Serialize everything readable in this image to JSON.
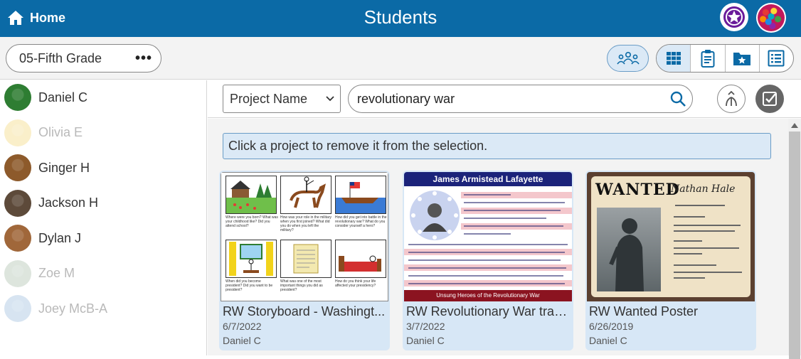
{
  "header": {
    "home_label": "Home",
    "title": "Students",
    "colors": {
      "bar": "#0b6aa6",
      "badge": "#6a1b9a"
    },
    "icons": {
      "home": "home-icon",
      "badge": "star-badge-icon",
      "avatar": "user-avatar"
    }
  },
  "toolbar": {
    "class_label": "05-Fifth Grade",
    "more_label": "•••",
    "icons": [
      "group-icon",
      "grid-view-icon",
      "clipboard-icon",
      "folder-star-icon",
      "list-view-icon"
    ]
  },
  "students": [
    {
      "name": "Daniel C",
      "dim": false,
      "color": "#2e7d32"
    },
    {
      "name": "Olivia E",
      "dim": true,
      "color": "#f1d36b"
    },
    {
      "name": "Ginger H",
      "dim": false,
      "color": "#8d5a2b"
    },
    {
      "name": "Jackson H",
      "dim": false,
      "color": "#5d4a3a"
    },
    {
      "name": "Dylan J",
      "dim": false,
      "color": "#a0673a"
    },
    {
      "name": "Zoe M",
      "dim": true,
      "color": "#9fb7a0"
    },
    {
      "name": "Joey McB-A",
      "dim": true,
      "color": "#8fb4d9"
    }
  ],
  "search": {
    "filter_label": "Project Name",
    "query": "revolutionary war"
  },
  "notice": "Click a project to remove it from the selection.",
  "projects": [
    {
      "title": "RW Storyboard - Washingt...",
      "date": "6/7/2022",
      "author": "Daniel C"
    },
    {
      "title": "RW Revolutionary War tradi...",
      "date": "3/7/2022",
      "author": "Daniel C",
      "poster_title": "James Armistead Lafayette",
      "poster_footer": "Unsung Heroes of the Revolutionary War"
    },
    {
      "title": "RW Wanted Poster",
      "date": "6/26/2019",
      "author": "Daniel C",
      "poster_title": "WANTED",
      "poster_name": "Nathan Hale"
    }
  ]
}
